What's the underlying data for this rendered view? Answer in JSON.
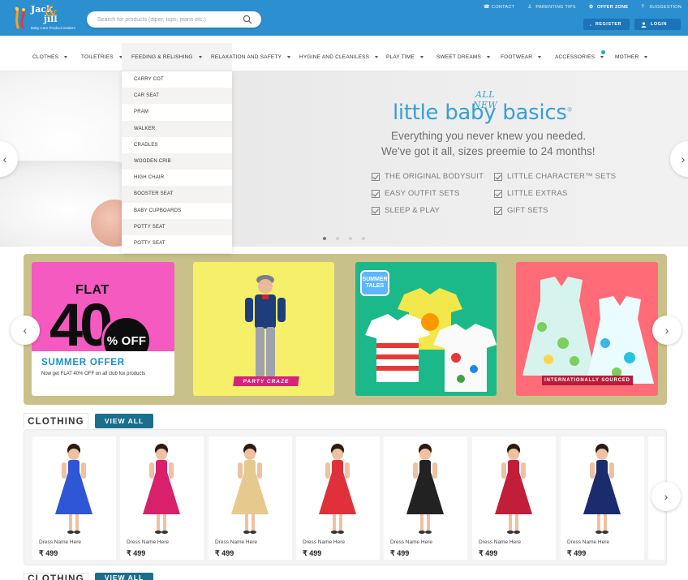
{
  "brand": {
    "name_line1": "Jack",
    "name_line2": "jill",
    "amp": "&",
    "tagline": "Baby Care Product Dealers"
  },
  "search": {
    "placeholder": "Search for products (diper, tops, jeans etc.)",
    "value": ""
  },
  "toplinks": [
    {
      "label": "CONTACT",
      "icon": "phone-icon"
    },
    {
      "label": "PARENTING TIPS",
      "icon": "baby-icon"
    },
    {
      "label": "OFFER ZONE",
      "icon": "tag-icon"
    },
    {
      "label": "SUGGESTION",
      "icon": "question-icon"
    }
  ],
  "auth": {
    "register": "REGISTER",
    "login": "LOGIN"
  },
  "nav": [
    {
      "label": "CLOTHES"
    },
    {
      "label": "TOILETRIES"
    },
    {
      "label": "FEEDING & RELISHING"
    },
    {
      "label": "RELAXATION AND SAFETY"
    },
    {
      "label": "HYGINE AND CLEANILESS"
    },
    {
      "label": "PLAY TIME"
    },
    {
      "label": "SWEET DREAMS"
    },
    {
      "label": "FOOTWEAR"
    },
    {
      "label": "ACCESSORIES"
    },
    {
      "label": "MOTHER"
    }
  ],
  "dropdown": [
    "CARRY COT",
    "CAR SEAT",
    "PRAM",
    "WALKER",
    "CRADLES",
    "WOODEN CRIB",
    "HIGH CHAIR",
    "BOOSTER SEAT",
    "BABY CUPBOARDS",
    "POTTY SEAT",
    "POTTY SEAT"
  ],
  "hero": {
    "all_new": "ALL NEW",
    "title": "little baby basics",
    "tm": "®",
    "sub1": "Everything you never knew you needed.",
    "sub2": "We've got it all, sizes preemie to 24 months!",
    "list": [
      "THE ORIGINAL BODYSUIT",
      "LITTLE CHARACTER™ SETS",
      "EASY OUTFIT SETS",
      "LITTLE EXTRAS",
      "SLEEP & PLAY",
      "GIFT SETS"
    ],
    "slides_total": 4,
    "active_slide": 1
  },
  "promo": {
    "flat": "FLAT",
    "big": "40",
    "off": "% OFF",
    "summer_title": "SUMMER OFFER",
    "summer_desc": "Now get FLAT 40% OFF on all club fox products",
    "card2_ribbon": "PARTY CRAZE",
    "card3_badge_line1": "SUMMER",
    "card3_badge_line2": "TALES",
    "card4_ribbon": "INTERNATIONALLY SOURCED"
  },
  "clothing": {
    "title": "CLOTHING",
    "view_all": "VIEW ALL",
    "products": [
      {
        "name": "Dress Name Here",
        "price": "₹ 499",
        "color": "#2f56d6"
      },
      {
        "name": "Dress Name Here",
        "price": "₹ 499",
        "color": "#d9206b"
      },
      {
        "name": "Dress Name Here",
        "price": "₹ 499",
        "color": "#e6c98d"
      },
      {
        "name": "Dress Name Here",
        "price": "₹ 499",
        "color": "#e0303a"
      },
      {
        "name": "Dress Name Here",
        "price": "₹ 499",
        "color": "#222222"
      },
      {
        "name": "Dress Name Here",
        "price": "₹ 499",
        "color": "#c21e3a"
      },
      {
        "name": "Dress Name Here",
        "price": "₹ 499",
        "color": "#1b2c6e"
      }
    ]
  },
  "clothing2": {
    "title": "CLOTHING",
    "view_all": "VIEW ALL"
  }
}
